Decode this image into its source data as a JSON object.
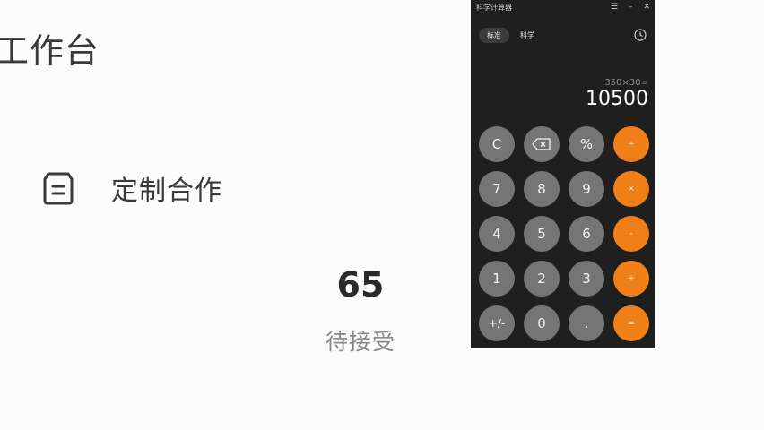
{
  "background": {
    "title": "工作台",
    "row_label": "定制合作",
    "row_icon": "document-icon",
    "stat_number": "65",
    "stat_label": "待接受"
  },
  "calculator": {
    "window_title": "科学计算器",
    "window_controls": [
      "restore-icon",
      "minimize-icon",
      "close-icon"
    ],
    "modes": [
      "标准",
      "科学"
    ],
    "active_mode": "标准",
    "expression": "350×30=",
    "result": "10500",
    "keys": [
      {
        "label": "C",
        "type": "func"
      },
      {
        "label": "",
        "type": "func",
        "icon": "backspace-icon"
      },
      {
        "label": "%",
        "type": "func"
      },
      {
        "label": "÷",
        "type": "op"
      },
      {
        "label": "7",
        "type": "num"
      },
      {
        "label": "8",
        "type": "num"
      },
      {
        "label": "9",
        "type": "num"
      },
      {
        "label": "×",
        "type": "op"
      },
      {
        "label": "4",
        "type": "num"
      },
      {
        "label": "5",
        "type": "num"
      },
      {
        "label": "6",
        "type": "num"
      },
      {
        "label": "-",
        "type": "op"
      },
      {
        "label": "1",
        "type": "num"
      },
      {
        "label": "2",
        "type": "num"
      },
      {
        "label": "3",
        "type": "num"
      },
      {
        "label": "+",
        "type": "op"
      },
      {
        "label": "+/-",
        "type": "func"
      },
      {
        "label": "0",
        "type": "num"
      },
      {
        "label": ".",
        "type": "num"
      },
      {
        "label": "=",
        "type": "op"
      }
    ],
    "colors": {
      "window_bg": "#1f1f1f",
      "key_bg": "#757575",
      "operator_bg": "#f07f17"
    }
  }
}
